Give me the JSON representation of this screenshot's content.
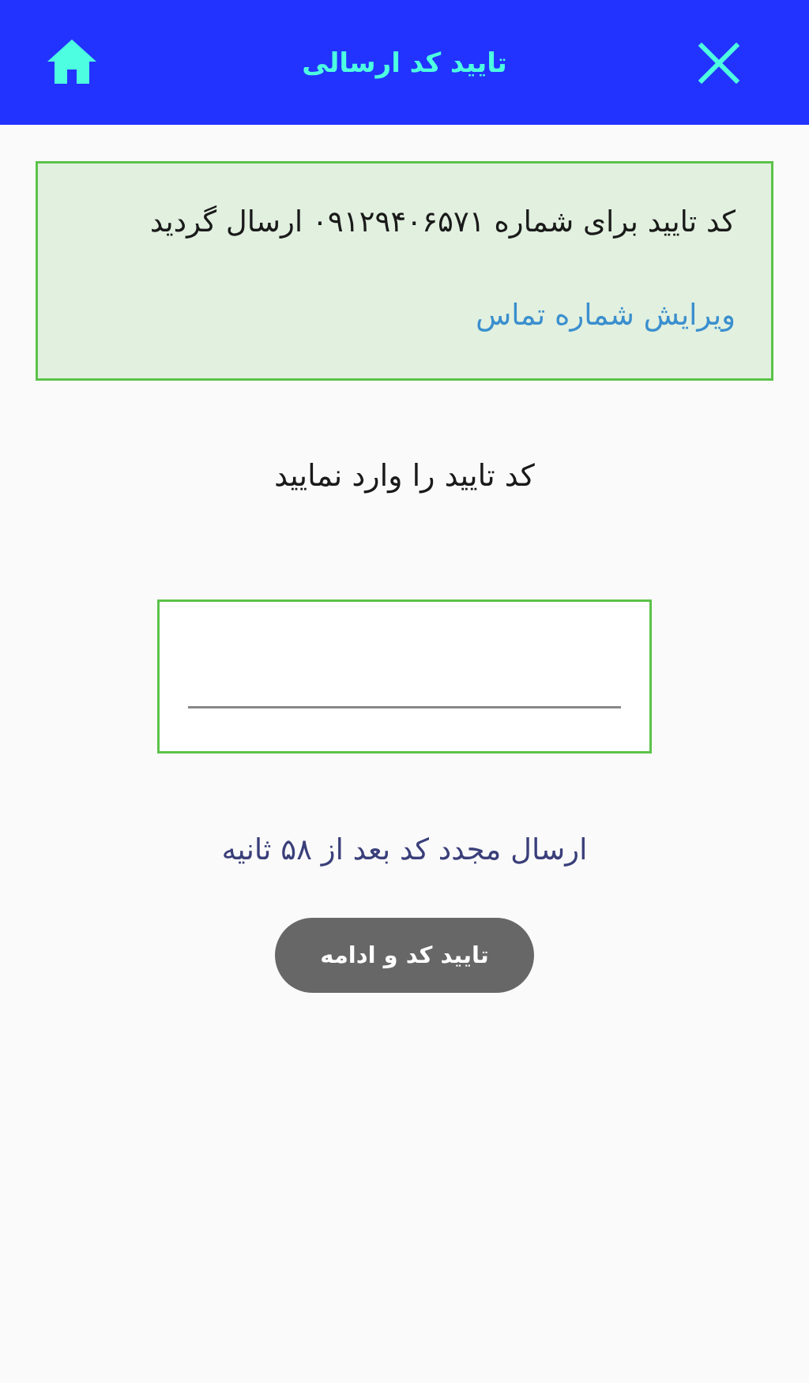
{
  "header": {
    "title": "تایید کد ارسالی",
    "home_icon": "home-icon",
    "close_icon": "close-icon",
    "background_color": "#2233ff",
    "accent_color": "#4dffe0"
  },
  "info": {
    "message": "کد تایید برای شماره ۰۹۱۲۹۴۰۶۵۷۱ ارسال گردید",
    "edit_link": "ویرایش شماره تماس",
    "border_color": "#5cc24a",
    "background_color": "#e1f0df"
  },
  "verification": {
    "prompt": "کد تایید را وارد نمایید",
    "code_value": "",
    "resend_text": "ارسال مجدد کد بعد از ۵۸ ثانیه",
    "submit_label": "تایید کد و ادامه"
  }
}
